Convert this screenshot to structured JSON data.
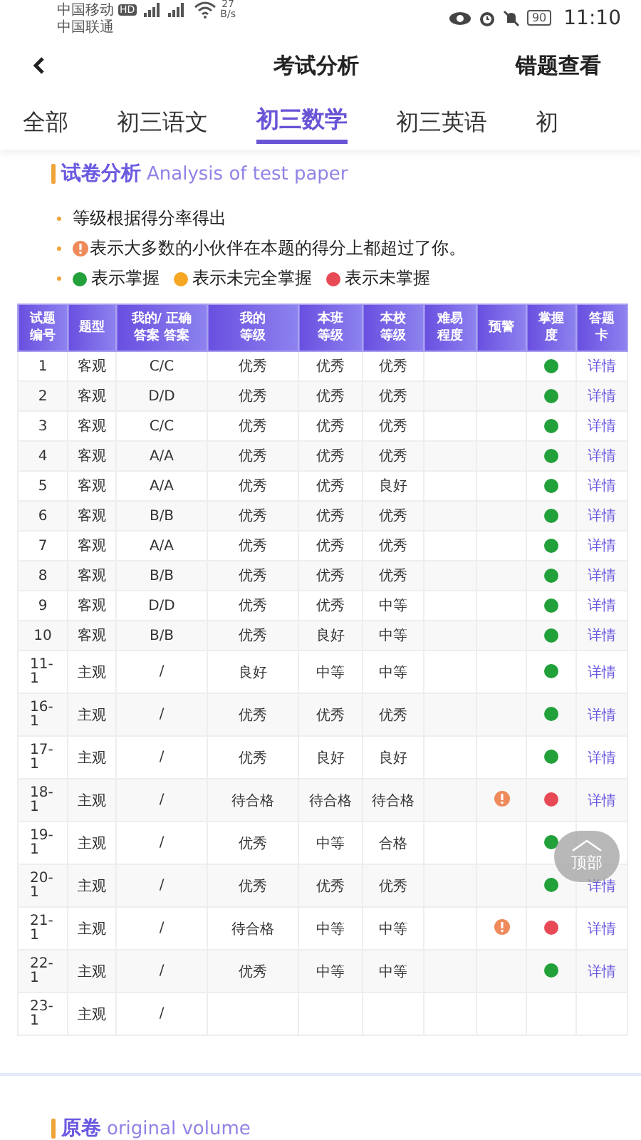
{
  "status_bar": {
    "carrier_1": "中国移动",
    "hd": "HD",
    "carrier_2": "中国联通",
    "speed_value": "27",
    "speed_unit": "B/s",
    "battery": "90",
    "time": "11:10"
  },
  "header": {
    "title": "考试分析",
    "action": "错题查看"
  },
  "tabs": [
    {
      "label": "全部",
      "selected": false
    },
    {
      "label": "初三语文",
      "selected": false
    },
    {
      "label": "初三数学",
      "selected": true
    },
    {
      "label": "初三英语",
      "selected": false
    },
    {
      "label": "初",
      "selected": false
    }
  ],
  "section": {
    "title": "试卷分析",
    "subtitle": "Analysis of test paper"
  },
  "notes": [
    {
      "kind": "text",
      "text": "等级根据得分率得出"
    },
    {
      "kind": "warning",
      "text": "表示大多数的小伙伴在本题的得分上都超过了你。"
    },
    {
      "kind": "legend",
      "items": [
        {
          "label": "表示掌握",
          "color": "#22a03a"
        },
        {
          "label": "表示未完全掌握",
          "color": "#f5a623"
        },
        {
          "label": "表示未掌握",
          "color": "#e84a55"
        }
      ]
    }
  ],
  "table": {
    "columns": [
      {
        "lines": [
          "试题",
          "编号"
        ]
      },
      {
        "lines": [
          "题型"
        ]
      },
      {
        "lines": [
          "我的/ 正确",
          "答案 答案"
        ]
      },
      {
        "lines": [
          "我的",
          "等级"
        ]
      },
      {
        "lines": [
          "本班",
          "等级"
        ]
      },
      {
        "lines": [
          "本校",
          "等级"
        ]
      },
      {
        "lines": [
          "难易",
          "程度"
        ]
      },
      {
        "lines": [
          "预警"
        ]
      },
      {
        "lines": [
          "掌握",
          "度"
        ]
      },
      {
        "lines": [
          "答题",
          "卡"
        ]
      }
    ],
    "rows": [
      {
        "no": "1",
        "type": "客观",
        "answer": "C/C",
        "mine": "优秀",
        "class": "优秀",
        "school": "优秀",
        "warning": false,
        "color": "#22a03a",
        "link": "详情"
      },
      {
        "no": "2",
        "type": "客观",
        "answer": "D/D",
        "mine": "优秀",
        "class": "优秀",
        "school": "优秀",
        "warning": false,
        "color": "#22a03a",
        "link": "详情"
      },
      {
        "no": "3",
        "type": "客观",
        "answer": "C/C",
        "mine": "优秀",
        "class": "优秀",
        "school": "优秀",
        "warning": false,
        "color": "#22a03a",
        "link": "详情"
      },
      {
        "no": "4",
        "type": "客观",
        "answer": "A/A",
        "mine": "优秀",
        "class": "优秀",
        "school": "优秀",
        "warning": false,
        "color": "#22a03a",
        "link": "详情"
      },
      {
        "no": "5",
        "type": "客观",
        "answer": "A/A",
        "mine": "优秀",
        "class": "优秀",
        "school": "良好",
        "warning": false,
        "color": "#22a03a",
        "link": "详情"
      },
      {
        "no": "6",
        "type": "客观",
        "answer": "B/B",
        "mine": "优秀",
        "class": "优秀",
        "school": "优秀",
        "warning": false,
        "color": "#22a03a",
        "link": "详情"
      },
      {
        "no": "7",
        "type": "客观",
        "answer": "A/A",
        "mine": "优秀",
        "class": "优秀",
        "school": "优秀",
        "warning": false,
        "color": "#22a03a",
        "link": "详情"
      },
      {
        "no": "8",
        "type": "客观",
        "answer": "B/B",
        "mine": "优秀",
        "class": "优秀",
        "school": "优秀",
        "warning": false,
        "color": "#22a03a",
        "link": "详情"
      },
      {
        "no": "9",
        "type": "客观",
        "answer": "D/D",
        "mine": "优秀",
        "class": "优秀",
        "school": "中等",
        "warning": false,
        "color": "#22a03a",
        "link": "详情"
      },
      {
        "no": "10",
        "type": "客观",
        "answer": "B/B",
        "mine": "优秀",
        "class": "良好",
        "school": "中等",
        "warning": false,
        "color": "#22a03a",
        "link": "详情"
      },
      {
        "no": "11-1",
        "type": "主观",
        "answer": "/",
        "mine": "良好",
        "class": "中等",
        "school": "中等",
        "warning": false,
        "color": "#22a03a",
        "link": "详情"
      },
      {
        "no": "16-1",
        "type": "主观",
        "answer": "/",
        "mine": "优秀",
        "class": "优秀",
        "school": "优秀",
        "warning": false,
        "color": "#22a03a",
        "link": "详情"
      },
      {
        "no": "17-1",
        "type": "主观",
        "answer": "/",
        "mine": "优秀",
        "class": "良好",
        "school": "良好",
        "warning": false,
        "color": "#22a03a",
        "link": "详情"
      },
      {
        "no": "18-1",
        "type": "主观",
        "answer": "/",
        "mine": "待合格",
        "class": "待合格",
        "school": "待合格",
        "warning": true,
        "color": "#e84a55",
        "link": "详情"
      },
      {
        "no": "19-1",
        "type": "主观",
        "answer": "/",
        "mine": "优秀",
        "class": "中等",
        "school": "合格",
        "warning": false,
        "color": "#22a03a"
      },
      {
        "no": "20-1",
        "type": "主观",
        "answer": "/",
        "mine": "优秀",
        "class": "优秀",
        "school": "优秀",
        "warning": false,
        "color": "#22a03a",
        "link": "详情"
      },
      {
        "no": "21-1",
        "type": "主观",
        "answer": "/",
        "mine": "待合格",
        "class": "中等",
        "school": "中等",
        "warning": true,
        "color": "#e84a55",
        "link": "详情"
      },
      {
        "no": "22-1",
        "type": "主观",
        "answer": "/",
        "mine": "优秀",
        "class": "中等",
        "school": "中等",
        "warning": false,
        "color": "#22a03a",
        "link": "详情"
      },
      {
        "no": "23-1",
        "type": "主观",
        "answer": "/",
        "warning": false
      }
    ]
  },
  "top_button": {
    "label": "顶部"
  },
  "next_section": {
    "title": "原卷",
    "subtitle": "original volume"
  }
}
